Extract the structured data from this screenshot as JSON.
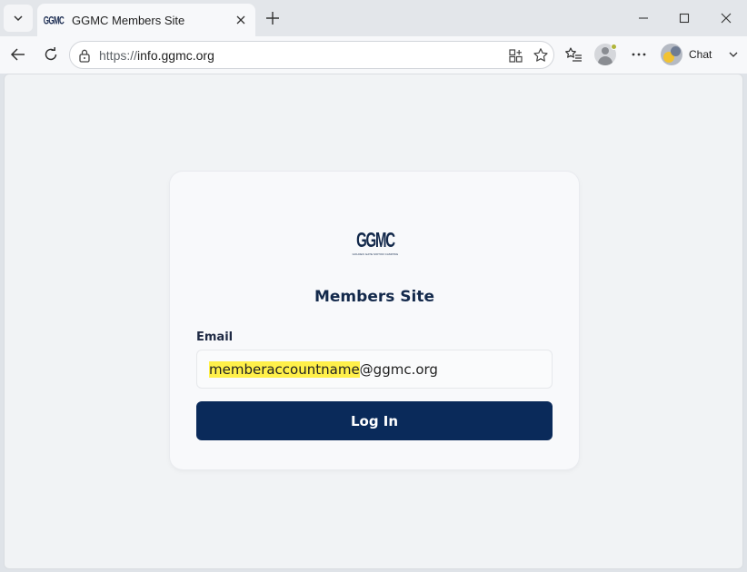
{
  "browser": {
    "tab": {
      "favicon_text": "GGMC",
      "title": "GGMC Members Site"
    },
    "address_bar": {
      "url_scheme": "https://",
      "url_host": "info.ggmc.org"
    },
    "chat_label": "Chat"
  },
  "page": {
    "logo": {
      "main": "GGMC",
      "tagline": "GOLDEN GATE MOTOR CAMPING"
    },
    "title": "Members Site",
    "email": {
      "label": "Email",
      "value_highlighted": "memberaccountname",
      "value_rest": "@ggmc.org"
    },
    "login_button": "Log In"
  },
  "colors": {
    "brand_navy": "#0a2a5a",
    "highlight": "#fff04a"
  }
}
